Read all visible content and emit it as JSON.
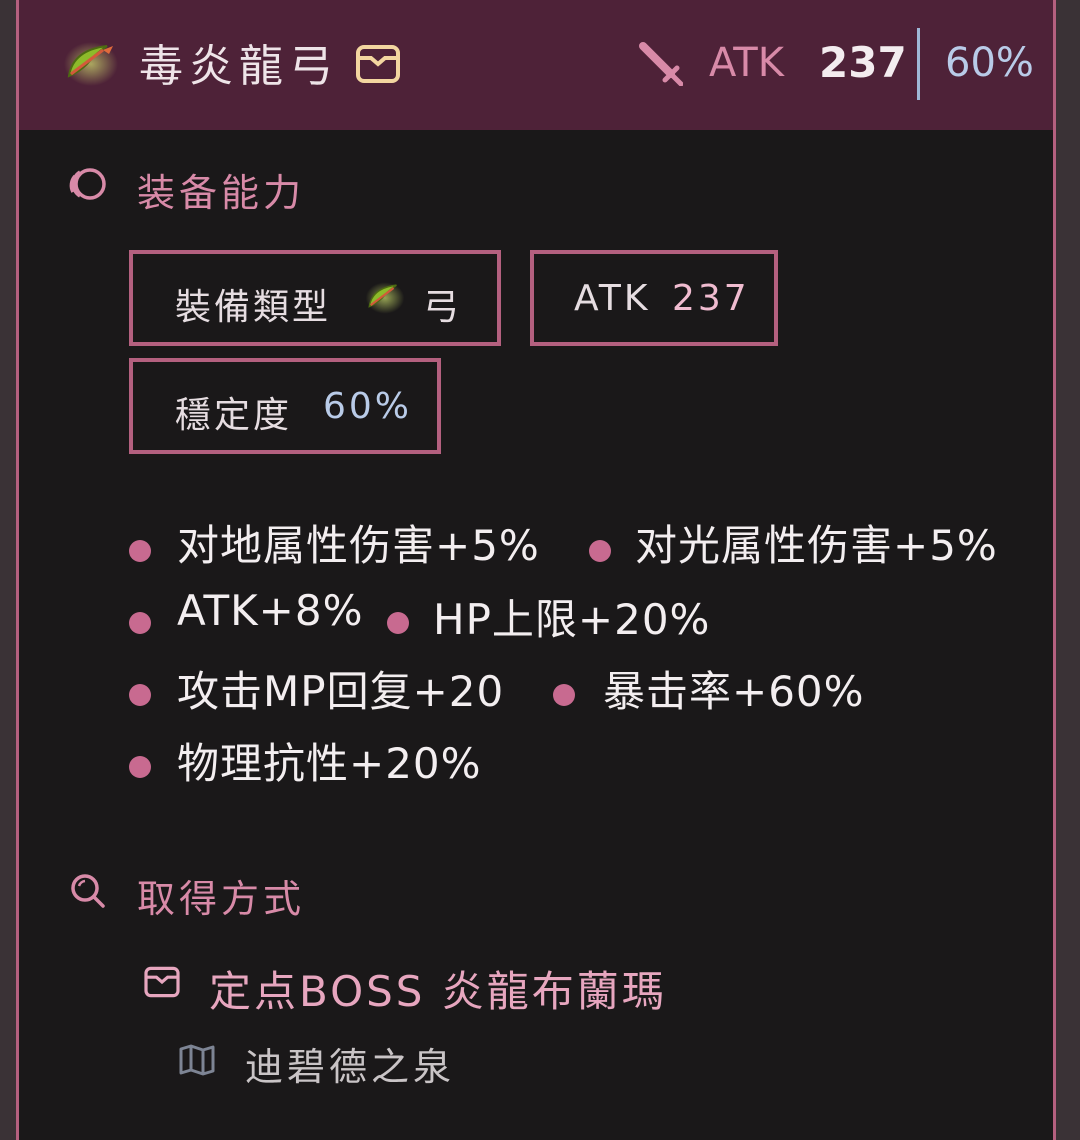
{
  "header": {
    "name": "毒炎龍弓",
    "atk_label": "ATK",
    "atk_value": "237",
    "stability": "60%"
  },
  "abilities": {
    "title": "装备能力",
    "type_label": "裝備類型",
    "type_value": "弓",
    "atk_label": "ATK",
    "atk_value": "237",
    "stability_label": "穩定度",
    "stability_value": "60%",
    "effects": [
      "对地属性伤害+5%",
      "对光属性伤害+5%",
      "ATK+8%",
      "HP上限+20%",
      "攻击MP回复+20",
      "暴击率+60%",
      "物理抗性+20%"
    ]
  },
  "obtain": {
    "title": "取得方式",
    "source": "定点BOSS  炎龍布蘭瑪",
    "location": "迪碧德之泉"
  },
  "icons": {
    "weapon": "bow-icon",
    "drop": "drop-box-icon",
    "atk": "sword-icon",
    "abilities": "swirl-icon",
    "obtain": "search-icon",
    "location": "map-icon"
  },
  "colors": {
    "accent": "#b4607f",
    "header_bg": "#4e2238",
    "card_bg": "#1a1819",
    "stability": "#b9cbe8"
  }
}
